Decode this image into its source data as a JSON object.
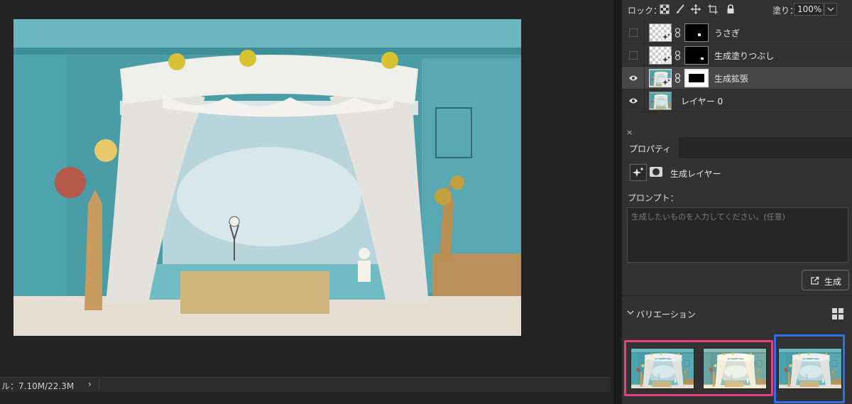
{
  "status": {
    "text": "ル：7.10M/22.3M",
    "chevron": "›"
  },
  "layers": {
    "lock_label": "ロック：",
    "fill_label": "塗り：",
    "fill_value": "100%",
    "items": [
      {
        "name": "うさぎ",
        "visible": false,
        "selected": false
      },
      {
        "name": "生成塗りつぶし",
        "visible": false,
        "selected": false
      },
      {
        "name": "生成拡張",
        "visible": true,
        "selected": true
      },
      {
        "name": "レイヤー 0",
        "visible": true,
        "selected": false
      }
    ]
  },
  "properties": {
    "close": "×",
    "tab": "プロパティ",
    "layer_type": "生成レイヤー",
    "prompt_label": "プロンプト：",
    "prompt_placeholder": "生成したいものを入力してください。(任意)",
    "prompt_value": "",
    "generate_label": "生成",
    "variations_label": "バリエーション"
  },
  "colors": {
    "highlight_pink": "#e8407a",
    "highlight_blue": "#2f6fe8",
    "panel_bg": "#323232",
    "selected_row": "#474747"
  },
  "icons": [
    "transparency-lock-icon",
    "brush-lock-icon",
    "move-lock-icon",
    "artboard-lock-icon",
    "padlock-icon",
    "eye-icon",
    "link-icon",
    "generative-sparkle-icon",
    "mask-icon",
    "export-icon",
    "chevron-down-icon",
    "grid-view-icon"
  ]
}
